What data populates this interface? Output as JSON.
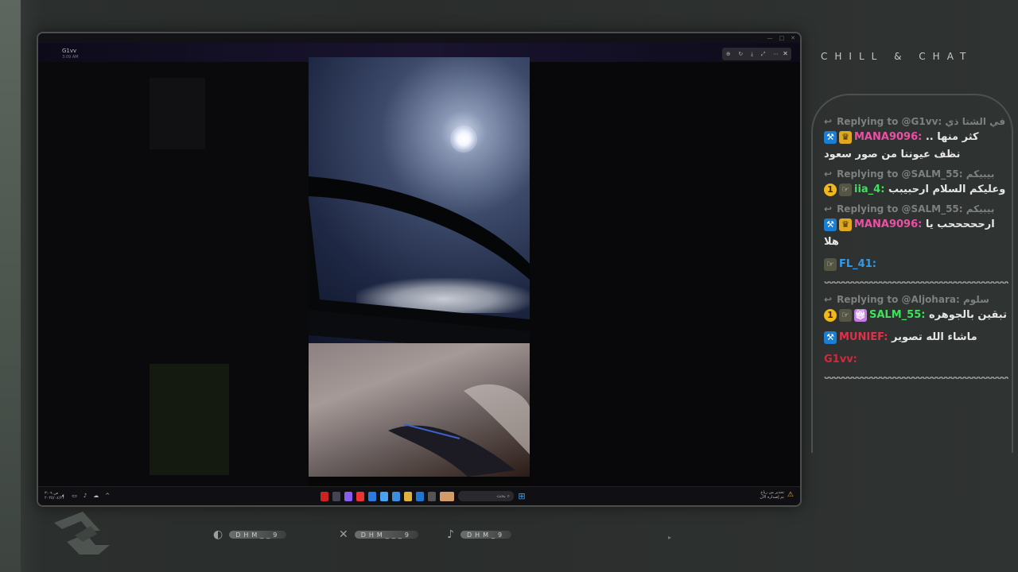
{
  "screen": {
    "user_name": "G1vv",
    "user_time": "3:09 AM",
    "viewer_tools": [
      "zoom-in",
      "rotate",
      "download",
      "expand",
      "more"
    ],
    "close_icon": "✕"
  },
  "taskbar": {
    "clock_time": "ص ٣:٠٩",
    "clock_date": "٢٠٢٥/٠٤/٢١",
    "search_placeholder": "بحث",
    "notification_line1": "تحذير من رياح",
    "notification_line2": "تم إصداره الآن"
  },
  "chat": {
    "title": "CHILL & CHAT",
    "messages": [
      {
        "type": "reply",
        "text": "Replying to @G1vv: في الشتا ذي"
      },
      {
        "type": "msg",
        "badges": [
          "blue",
          "crown"
        ],
        "name": "MANA9096:",
        "name_color": "pink",
        "text": "كثر منها .. نظف عيوننا من صور سعود"
      },
      {
        "type": "reply",
        "text": "Replying to @SALM_55: بيبيكم"
      },
      {
        "type": "msg",
        "badges": [
          "one",
          "emote"
        ],
        "name": "iia_4:",
        "name_color": "green",
        "text": "وعليكم السلام ارحبيبب"
      },
      {
        "type": "reply",
        "text": "Replying to @SALM_55: بيبيكم"
      },
      {
        "type": "msg",
        "badges": [
          "blue",
          "crown"
        ],
        "name": "MANA9096:",
        "name_color": "pink",
        "text": "ارحححححب يا هلا"
      },
      {
        "type": "msg",
        "badges": [
          "emote"
        ],
        "name": "FL_41:",
        "name_color": "blue",
        "text": ""
      },
      {
        "type": "divider"
      },
      {
        "type": "reply",
        "text": "Replying to @Aljohara: سلوم"
      },
      {
        "type": "msg",
        "badges": [
          "one",
          "emote",
          "gift"
        ],
        "name": "SALM_55:",
        "name_color": "green",
        "text": "تبقين بالجوهره"
      },
      {
        "type": "msg",
        "badges": [
          "blue"
        ],
        "name": "MUNIEF:",
        "name_color": "red",
        "text": "ماشاء الله تصوير"
      },
      {
        "type": "msg",
        "badges": [],
        "name": "G1vv:",
        "name_color": "crimson",
        "text": ""
      },
      {
        "type": "divider"
      }
    ]
  },
  "socials": [
    {
      "icon": "snapchat-icon",
      "glyph": "◐",
      "handle": "DHM__9"
    },
    {
      "icon": "x-icon",
      "glyph": "✕",
      "handle": "DHM___9"
    },
    {
      "icon": "tiktok-icon",
      "glyph": "♪",
      "handle": "DHM_9"
    }
  ],
  "divider_text": "ᴗᴗᴗᴗᴗᴗᴗᴗᴗᴗᴗᴗᴗᴗᴗᴗᴗᴗᴗᴗᴗᴗᴗᴗᴗᴗᴗᴗᴗᴗᴗᴗᴗᴗᴗᴗᴗᴗᴗᴗᴗᴗ"
}
